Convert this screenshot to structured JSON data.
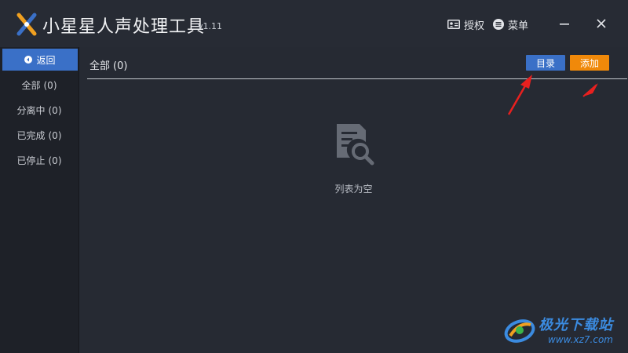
{
  "app": {
    "title": "小星星人声处理工具",
    "version": "v1.11"
  },
  "titlebar": {
    "license_label": "授权",
    "menu_label": "菜单",
    "license_icon": "license-card-icon",
    "menu_icon": "menu-icon",
    "minimize_icon": "minimize-icon",
    "close_icon": "close-icon"
  },
  "sidebar": {
    "back_label": "返回",
    "items": [
      {
        "label": "全部",
        "count": "(0)"
      },
      {
        "label": "分离中",
        "count": "(0)"
      },
      {
        "label": "已完成",
        "count": "(0)"
      },
      {
        "label": "已停止",
        "count": "(0)"
      }
    ]
  },
  "main": {
    "filter_label": "全部",
    "filter_count": "(0)",
    "directory_button": "目录",
    "add_button": "添加",
    "empty_text": "列表为空",
    "empty_icon": "document-search-icon"
  },
  "watermark": {
    "text": "极光下载站",
    "url": "www.xz7.com"
  },
  "colors": {
    "background": "#262a33",
    "sidebar": "#1e2128",
    "accent_blue": "#3a70c7",
    "accent_orange": "#f0890a",
    "annotation_red": "#e8201f"
  }
}
